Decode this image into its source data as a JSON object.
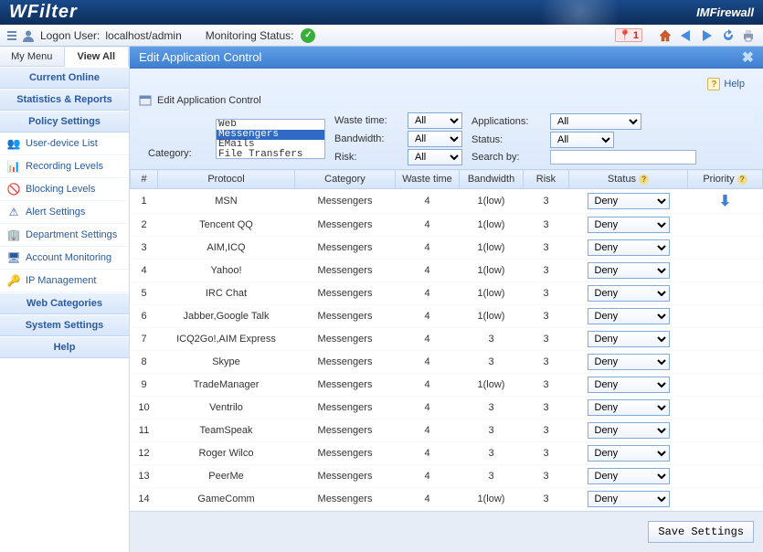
{
  "brand": {
    "logo": "WFilter",
    "company": "IMFirewall"
  },
  "status_bar": {
    "logon_label": "Logon User:",
    "logon_user": "localhost/admin",
    "monitoring_label": "Monitoring Status:",
    "alert_count": "1"
  },
  "sidebar": {
    "tabs": {
      "my_menu": "My Menu",
      "view_all": "View All"
    },
    "sections": {
      "current_online": "Current Online",
      "stats_reports": "Statistics & Reports",
      "policy_settings": "Policy Settings",
      "web_categories": "Web Categories",
      "system_settings": "System Settings",
      "help": "Help"
    },
    "items": {
      "user_device_list": "User-device List",
      "recording_levels": "Recording Levels",
      "blocking_levels": "Blocking Levels",
      "alert_settings": "Alert Settings",
      "department_settings": "Department Settings",
      "account_monitoring": "Account Monitoring",
      "ip_management": "IP Management"
    }
  },
  "content": {
    "title": "Edit Application Control",
    "help_label": "Help",
    "breadcrumb": "Edit Application Control",
    "filters": {
      "category_label": "Category:",
      "category_options": [
        "Web",
        "Messengers",
        "EMails",
        "File Transfers"
      ],
      "category_selected": "Messengers",
      "waste_time_label": "Waste time:",
      "waste_time_value": "All",
      "bandwidth_label": "Bandwidth:",
      "bandwidth_value": "All",
      "risk_label": "Risk:",
      "risk_value": "All",
      "applications_label": "Applications:",
      "applications_value": "All",
      "status_label": "Status:",
      "status_value": "All",
      "search_label": "Search by:",
      "search_value": ""
    },
    "columns": {
      "num": "#",
      "protocol": "Protocol",
      "category": "Category",
      "waste_time": "Waste time",
      "bandwidth": "Bandwidth",
      "risk": "Risk",
      "status": "Status",
      "priority": "Priority"
    },
    "rows": [
      {
        "n": 1,
        "protocol": "MSN",
        "category": "Messengers",
        "waste": 4,
        "bw": "1(low)",
        "risk": 3,
        "status": "Deny",
        "priority_arrow": true
      },
      {
        "n": 2,
        "protocol": "Tencent QQ",
        "category": "Messengers",
        "waste": 4,
        "bw": "1(low)",
        "risk": 3,
        "status": "Deny"
      },
      {
        "n": 3,
        "protocol": "AIM,ICQ",
        "category": "Messengers",
        "waste": 4,
        "bw": "1(low)",
        "risk": 3,
        "status": "Deny"
      },
      {
        "n": 4,
        "protocol": "Yahoo!",
        "category": "Messengers",
        "waste": 4,
        "bw": "1(low)",
        "risk": 3,
        "status": "Deny"
      },
      {
        "n": 5,
        "protocol": "IRC Chat",
        "category": "Messengers",
        "waste": 4,
        "bw": "1(low)",
        "risk": 3,
        "status": "Deny"
      },
      {
        "n": 6,
        "protocol": "Jabber,Google Talk",
        "category": "Messengers",
        "waste": 4,
        "bw": "1(low)",
        "risk": 3,
        "status": "Deny"
      },
      {
        "n": 7,
        "protocol": "ICQ2Go!,AIM Express",
        "category": "Messengers",
        "waste": 4,
        "bw": "3",
        "risk": 3,
        "status": "Deny"
      },
      {
        "n": 8,
        "protocol": "Skype",
        "category": "Messengers",
        "waste": 4,
        "bw": "3",
        "risk": 3,
        "status": "Deny"
      },
      {
        "n": 9,
        "protocol": "TradeManager",
        "category": "Messengers",
        "waste": 4,
        "bw": "1(low)",
        "risk": 3,
        "status": "Deny"
      },
      {
        "n": 10,
        "protocol": "Ventrilo",
        "category": "Messengers",
        "waste": 4,
        "bw": "3",
        "risk": 3,
        "status": "Deny"
      },
      {
        "n": 11,
        "protocol": "TeamSpeak",
        "category": "Messengers",
        "waste": 4,
        "bw": "3",
        "risk": 3,
        "status": "Deny"
      },
      {
        "n": 12,
        "protocol": "Roger Wilco",
        "category": "Messengers",
        "waste": 4,
        "bw": "3",
        "risk": 3,
        "status": "Deny"
      },
      {
        "n": 13,
        "protocol": "PeerMe",
        "category": "Messengers",
        "waste": 4,
        "bw": "3",
        "risk": 3,
        "status": "Deny"
      },
      {
        "n": 14,
        "protocol": "GameComm",
        "category": "Messengers",
        "waste": 4,
        "bw": "1(low)",
        "risk": 3,
        "status": "Deny"
      }
    ],
    "save_button": "Save Settings"
  }
}
